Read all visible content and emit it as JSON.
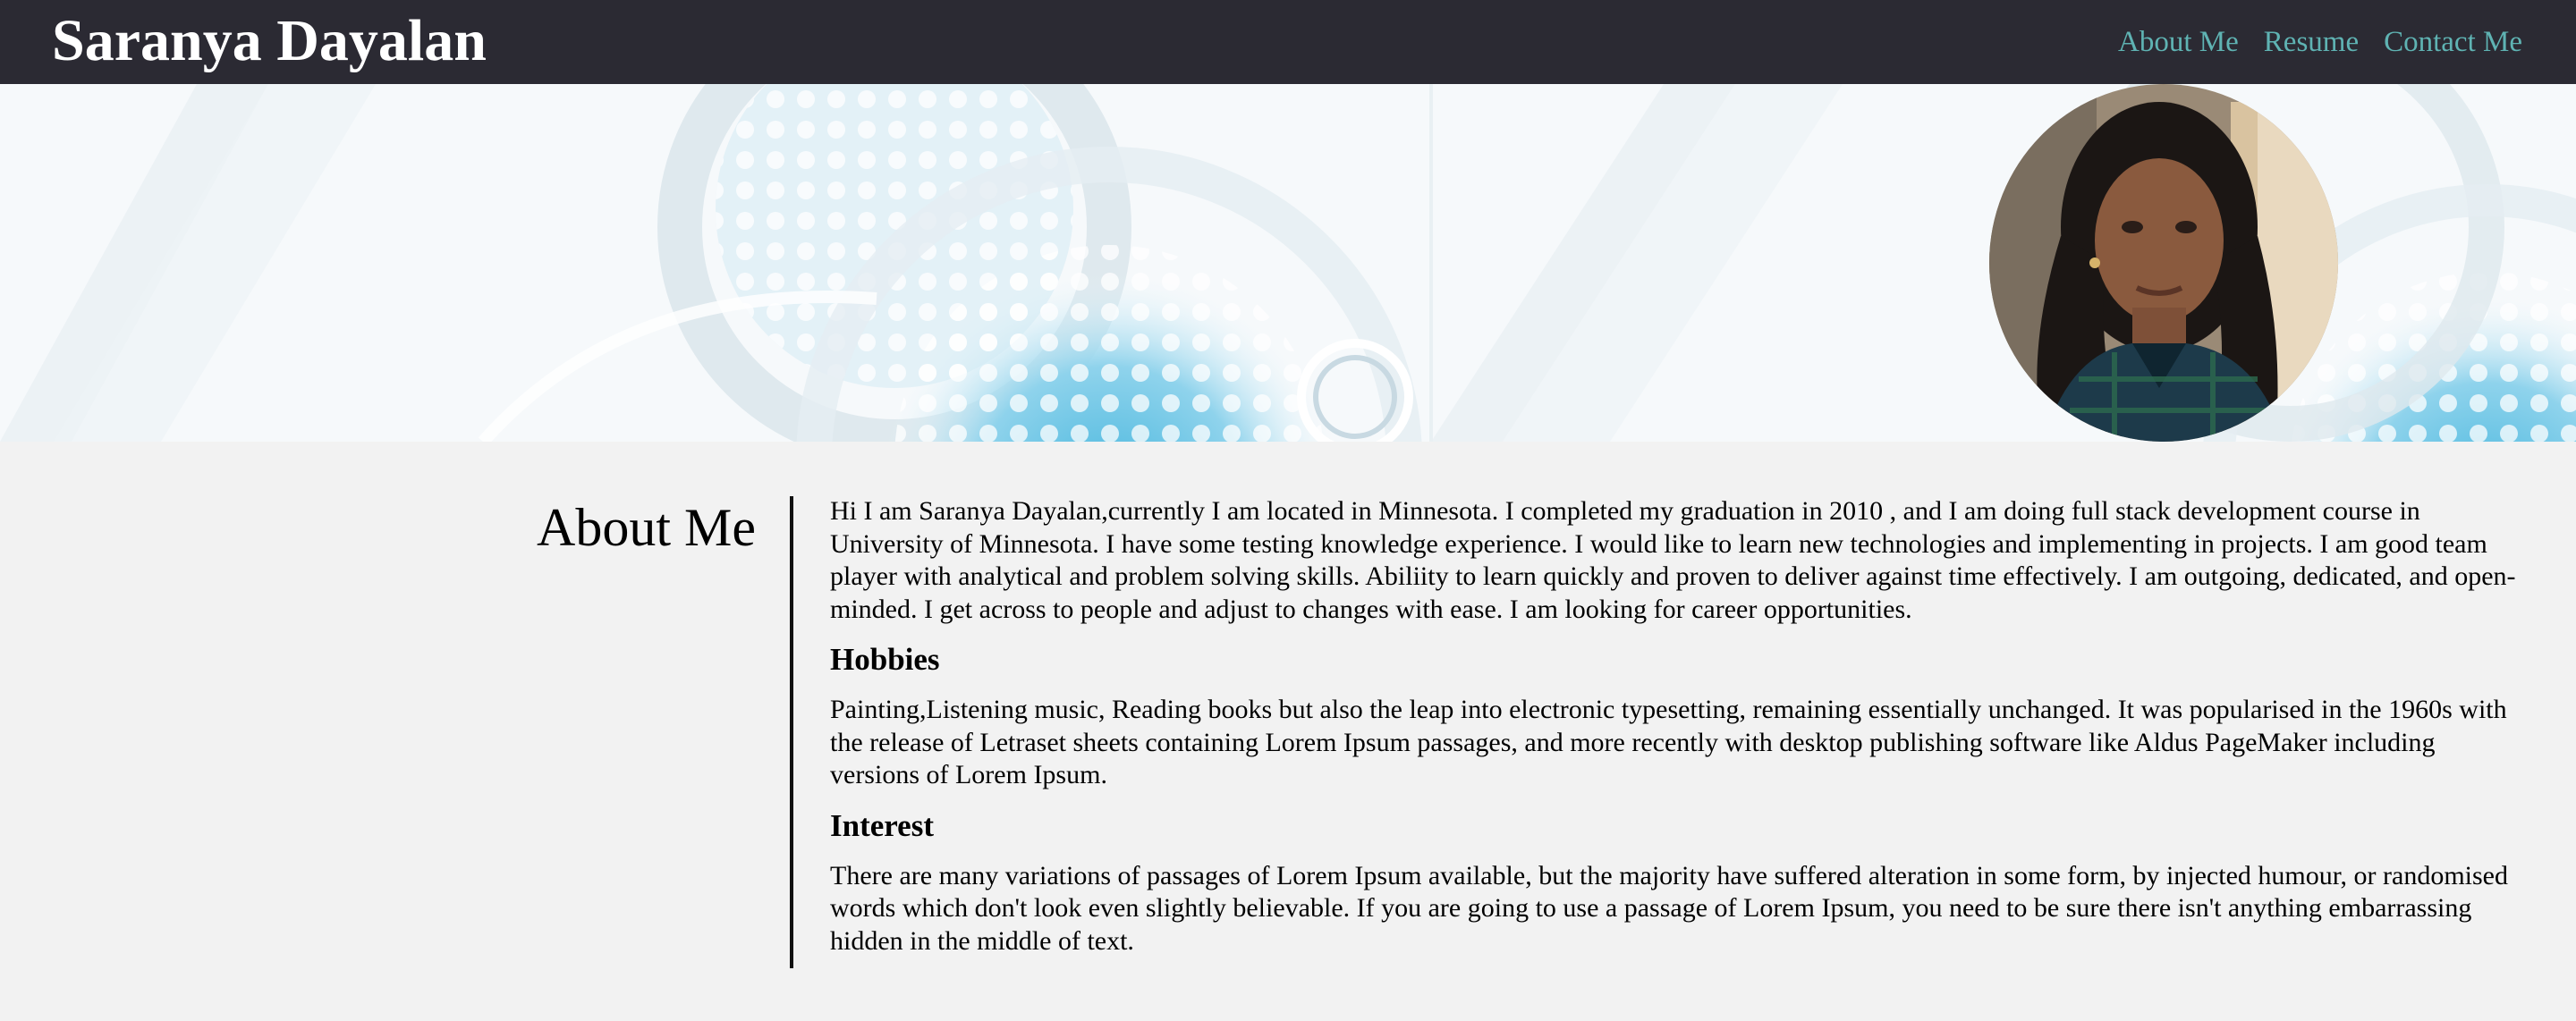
{
  "header": {
    "site_title": "Saranya Dayalan",
    "nav": [
      {
        "label": "About Me"
      },
      {
        "label": "Resume"
      },
      {
        "label": "Contact Me"
      }
    ]
  },
  "colors": {
    "nav_background": "#2b2a33",
    "nav_link": "#5fb3b3",
    "page_background": "#f2f2f2"
  },
  "about": {
    "heading": "About Me",
    "intro": "Hi I am Saranya Dayalan,currently I am located in Minnesota. I completed my graduation in 2010 , and I am doing full stack development course in University of Minnesota. I have some testing knowledge experience. I would like to learn new technologies and implementing in projects. I am good team player with analytical and problem solving skills. Abiliity to learn quickly and proven to deliver against time effectively. I am outgoing, dedicated, and open-minded. I get across to people and adjust to changes with ease. I am looking for career opportunities.",
    "hobbies_heading": "Hobbies",
    "hobbies_text": "Painting,Listening music, Reading books but also the leap into electronic typesetting, remaining essentially unchanged. It was popularised in the 1960s with the release of Letraset sheets containing Lorem Ipsum passages, and more recently with desktop publishing software like Aldus PageMaker including versions of Lorem Ipsum.",
    "interest_heading": "Interest",
    "interest_text": "There are many variations of passages of Lorem Ipsum available, but the majority have suffered alteration in some form, by injected humour, or randomised words which don't look even slightly believable. If you are going to use a passage of Lorem Ipsum, you need to be sure there isn't anything embarrassing hidden in the middle of text."
  }
}
